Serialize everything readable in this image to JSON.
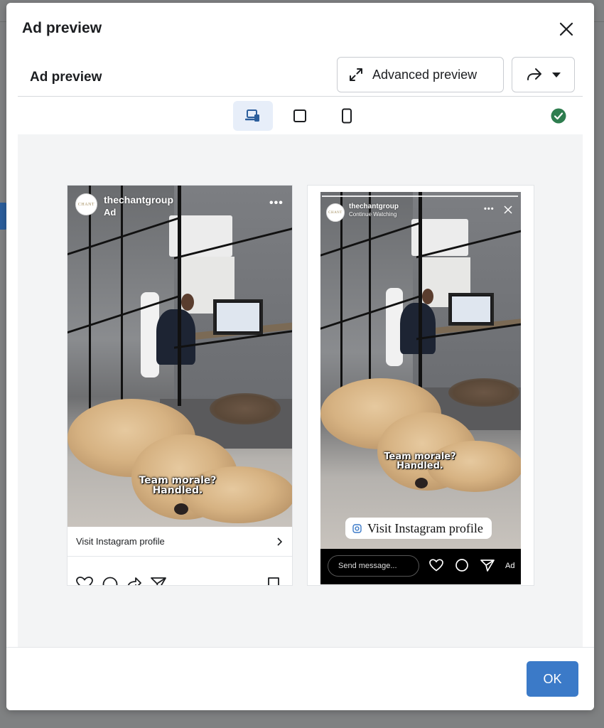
{
  "modal": {
    "title": "Ad preview",
    "sub_title": "Ad preview",
    "advanced_preview_label": "Advanced preview",
    "ok_label": "OK"
  },
  "toolbar": {
    "icons": [
      "desktop-mobile-icon",
      "square-icon",
      "phone-icon"
    ],
    "status_icon": "check-circle-icon",
    "status_color": "#2e7d4f"
  },
  "feed_preview": {
    "account": "thechantgroup",
    "sub_label": "Ad",
    "avatar_text": "CHANT",
    "caption_line1": "Team morale?",
    "caption_line2": "Handled.",
    "cta_label": "Visit Instagram profile"
  },
  "story_preview": {
    "account": "thechantgroup",
    "sub_label": "Continue Watching",
    "avatar_text": "CHANT",
    "caption_line1": "Team morale?",
    "caption_line2": "Handled.",
    "cta_label": "Visit Instagram profile",
    "message_placeholder": "Send message...",
    "ad_label": "Ad"
  },
  "colors": {
    "primary_button": "#3b7ac8",
    "active_tab_bg": "#e7eef9"
  }
}
